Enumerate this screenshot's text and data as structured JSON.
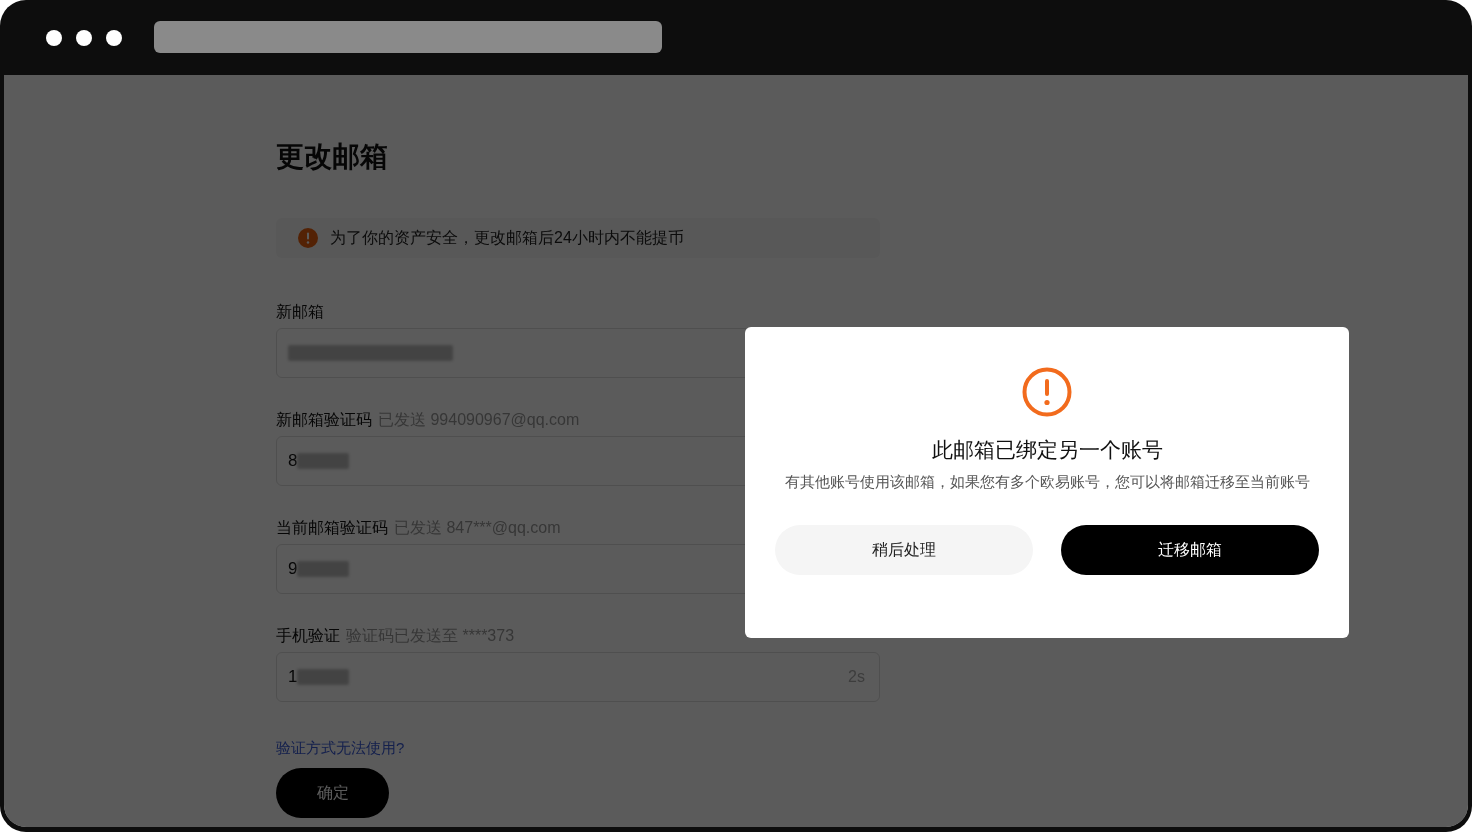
{
  "page": {
    "title": "更改邮箱",
    "notice": "为了你的资产安全，更改邮箱后24小时内不能提币",
    "fields": [
      {
        "label": "新邮箱",
        "redacted": true
      },
      {
        "label": "新邮箱验证码",
        "hint": "已发送 994090967@qq.com",
        "value": "8",
        "redacted": true
      },
      {
        "label": "当前邮箱验证码",
        "hint": "已发送 847***@qq.com",
        "value": "9",
        "redacted": true
      },
      {
        "label": "手机验证",
        "hint": "验证码已发送至 ****373",
        "value": "1",
        "redacted": true,
        "countdown": "2s"
      }
    ],
    "help_link": "验证方式无法使用?",
    "submit": "确定"
  },
  "dialog": {
    "title": "此邮箱已绑定另一个账号",
    "message": "有其他账号使用该邮箱，如果您有多个欧易账号，您可以将邮箱迁移至当前账号",
    "buttons": [
      {
        "label": "稍后处理",
        "kind": "secondary"
      },
      {
        "label": "迁移邮箱",
        "kind": "primary"
      }
    ]
  }
}
